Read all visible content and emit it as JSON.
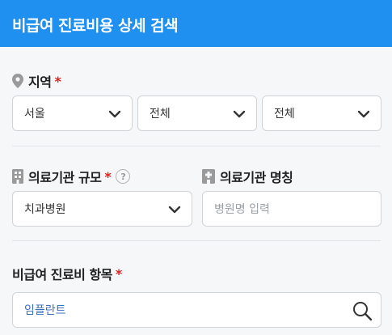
{
  "header": {
    "title": "비급여 진료비용 상세 검색"
  },
  "region": {
    "label": "지역",
    "required": "*",
    "selects": [
      "서울",
      "전체",
      "전체"
    ]
  },
  "scale": {
    "label": "의료기관 규모",
    "required": "*",
    "help": "?",
    "value": "치과병원"
  },
  "name": {
    "label": "의료기관 명칭",
    "placeholder": "병원명 입력"
  },
  "item": {
    "label": "비급여 진료비 항목",
    "required": "*",
    "value": "임플란트"
  },
  "colors": {
    "header": "#1f8ff0",
    "required": "#e02020",
    "search_text": "#3b6fc0"
  },
  "icons": [
    "map-pin-icon",
    "building-icon",
    "hospital-icon",
    "chevron-down-icon",
    "search-icon",
    "help-icon"
  ]
}
